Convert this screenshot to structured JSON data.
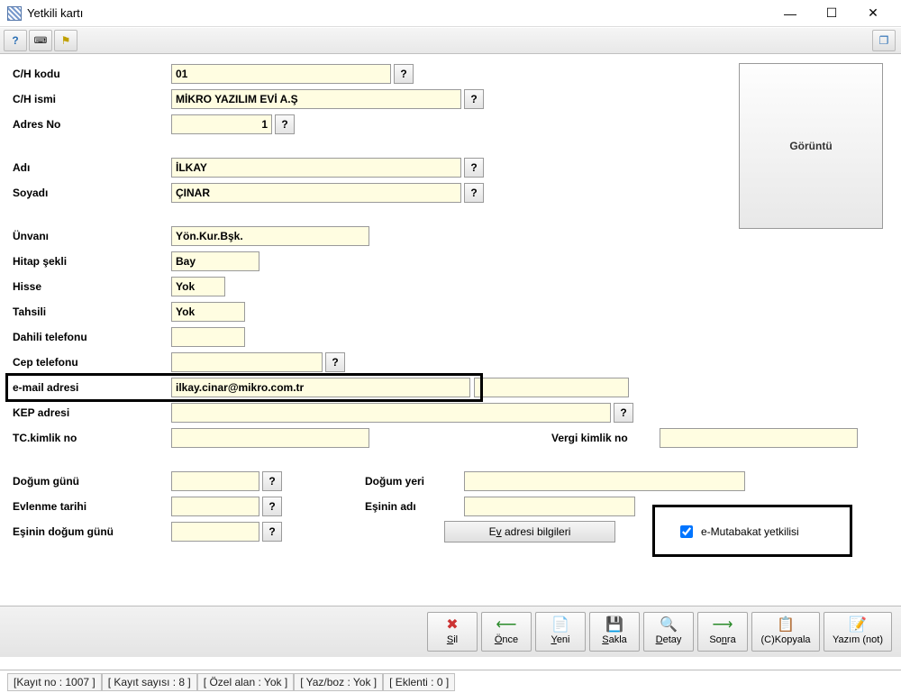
{
  "window": {
    "title": "Yetkili kartı"
  },
  "image_box": {
    "label": "Görüntü"
  },
  "fields": {
    "ch_kodu_label": "C/H kodu",
    "ch_kodu": "01",
    "ch_ismi_label": "C/H ismi",
    "ch_ismi": "MİKRO YAZILIM EVİ A.Ş",
    "adres_no_label": "Adres No",
    "adres_no": "1",
    "adi_label": "Adı",
    "adi": "İLKAY",
    "soyadi_label": "Soyadı",
    "soyadi": "ÇINAR",
    "unvani_label": "Ünvanı",
    "unvani": "Yön.Kur.Bşk.",
    "hitap_label": "Hitap şekli",
    "hitap": "Bay",
    "hisse_label": "Hisse",
    "hisse": "Yok",
    "tahsili_label": "Tahsili",
    "tahsili": "Yok",
    "dahili_label": "Dahili telefonu",
    "dahili": "",
    "cep_label": "Cep telefonu",
    "cep": "",
    "email_label": "e-mail adresi",
    "email": "ilkay.cinar@mikro.com.tr",
    "kep_label": "KEP adresi",
    "kep": "",
    "tckimlik_label": "TC.kimlik no",
    "tckimlik": "",
    "vergino_label": "Vergi kimlik no",
    "vergino": "",
    "dogum_gunu_label": "Doğum günü",
    "dogum_gunu": "",
    "dogum_yeri_label": "Doğum yeri",
    "dogum_yeri": "",
    "evlenme_label": "Evlenme tarihi",
    "evlenme": "",
    "es_adi_label": "Eşinin adı",
    "es_adi": "",
    "es_dogum_label": "Eşinin doğum günü",
    "es_dogum": "",
    "ev_adres_btn": "Ev adresi bilgileri",
    "emutabakat_label": "e-Mutabakat yetkilisi",
    "emutabakat_checked": true
  },
  "footer": {
    "sil": "Sil",
    "once": "Önce",
    "yeni": "Yeni",
    "sakla": "Sakla",
    "detay": "Detay",
    "sonra": "Sonra",
    "kopyala": "(C)Kopyala",
    "yazim": "Yazım (not)"
  },
  "status": {
    "kayit_no": "[Kayıt no : 1007 ]",
    "kayit_sayisi": "[ Kayıt sayısı : 8 ]",
    "ozel_alan": "[ Özel alan : Yok ]",
    "yazboz": "[ Yaz/boz : Yok ]",
    "eklenti": "[ Eklenti : 0 ]"
  },
  "q": "?"
}
